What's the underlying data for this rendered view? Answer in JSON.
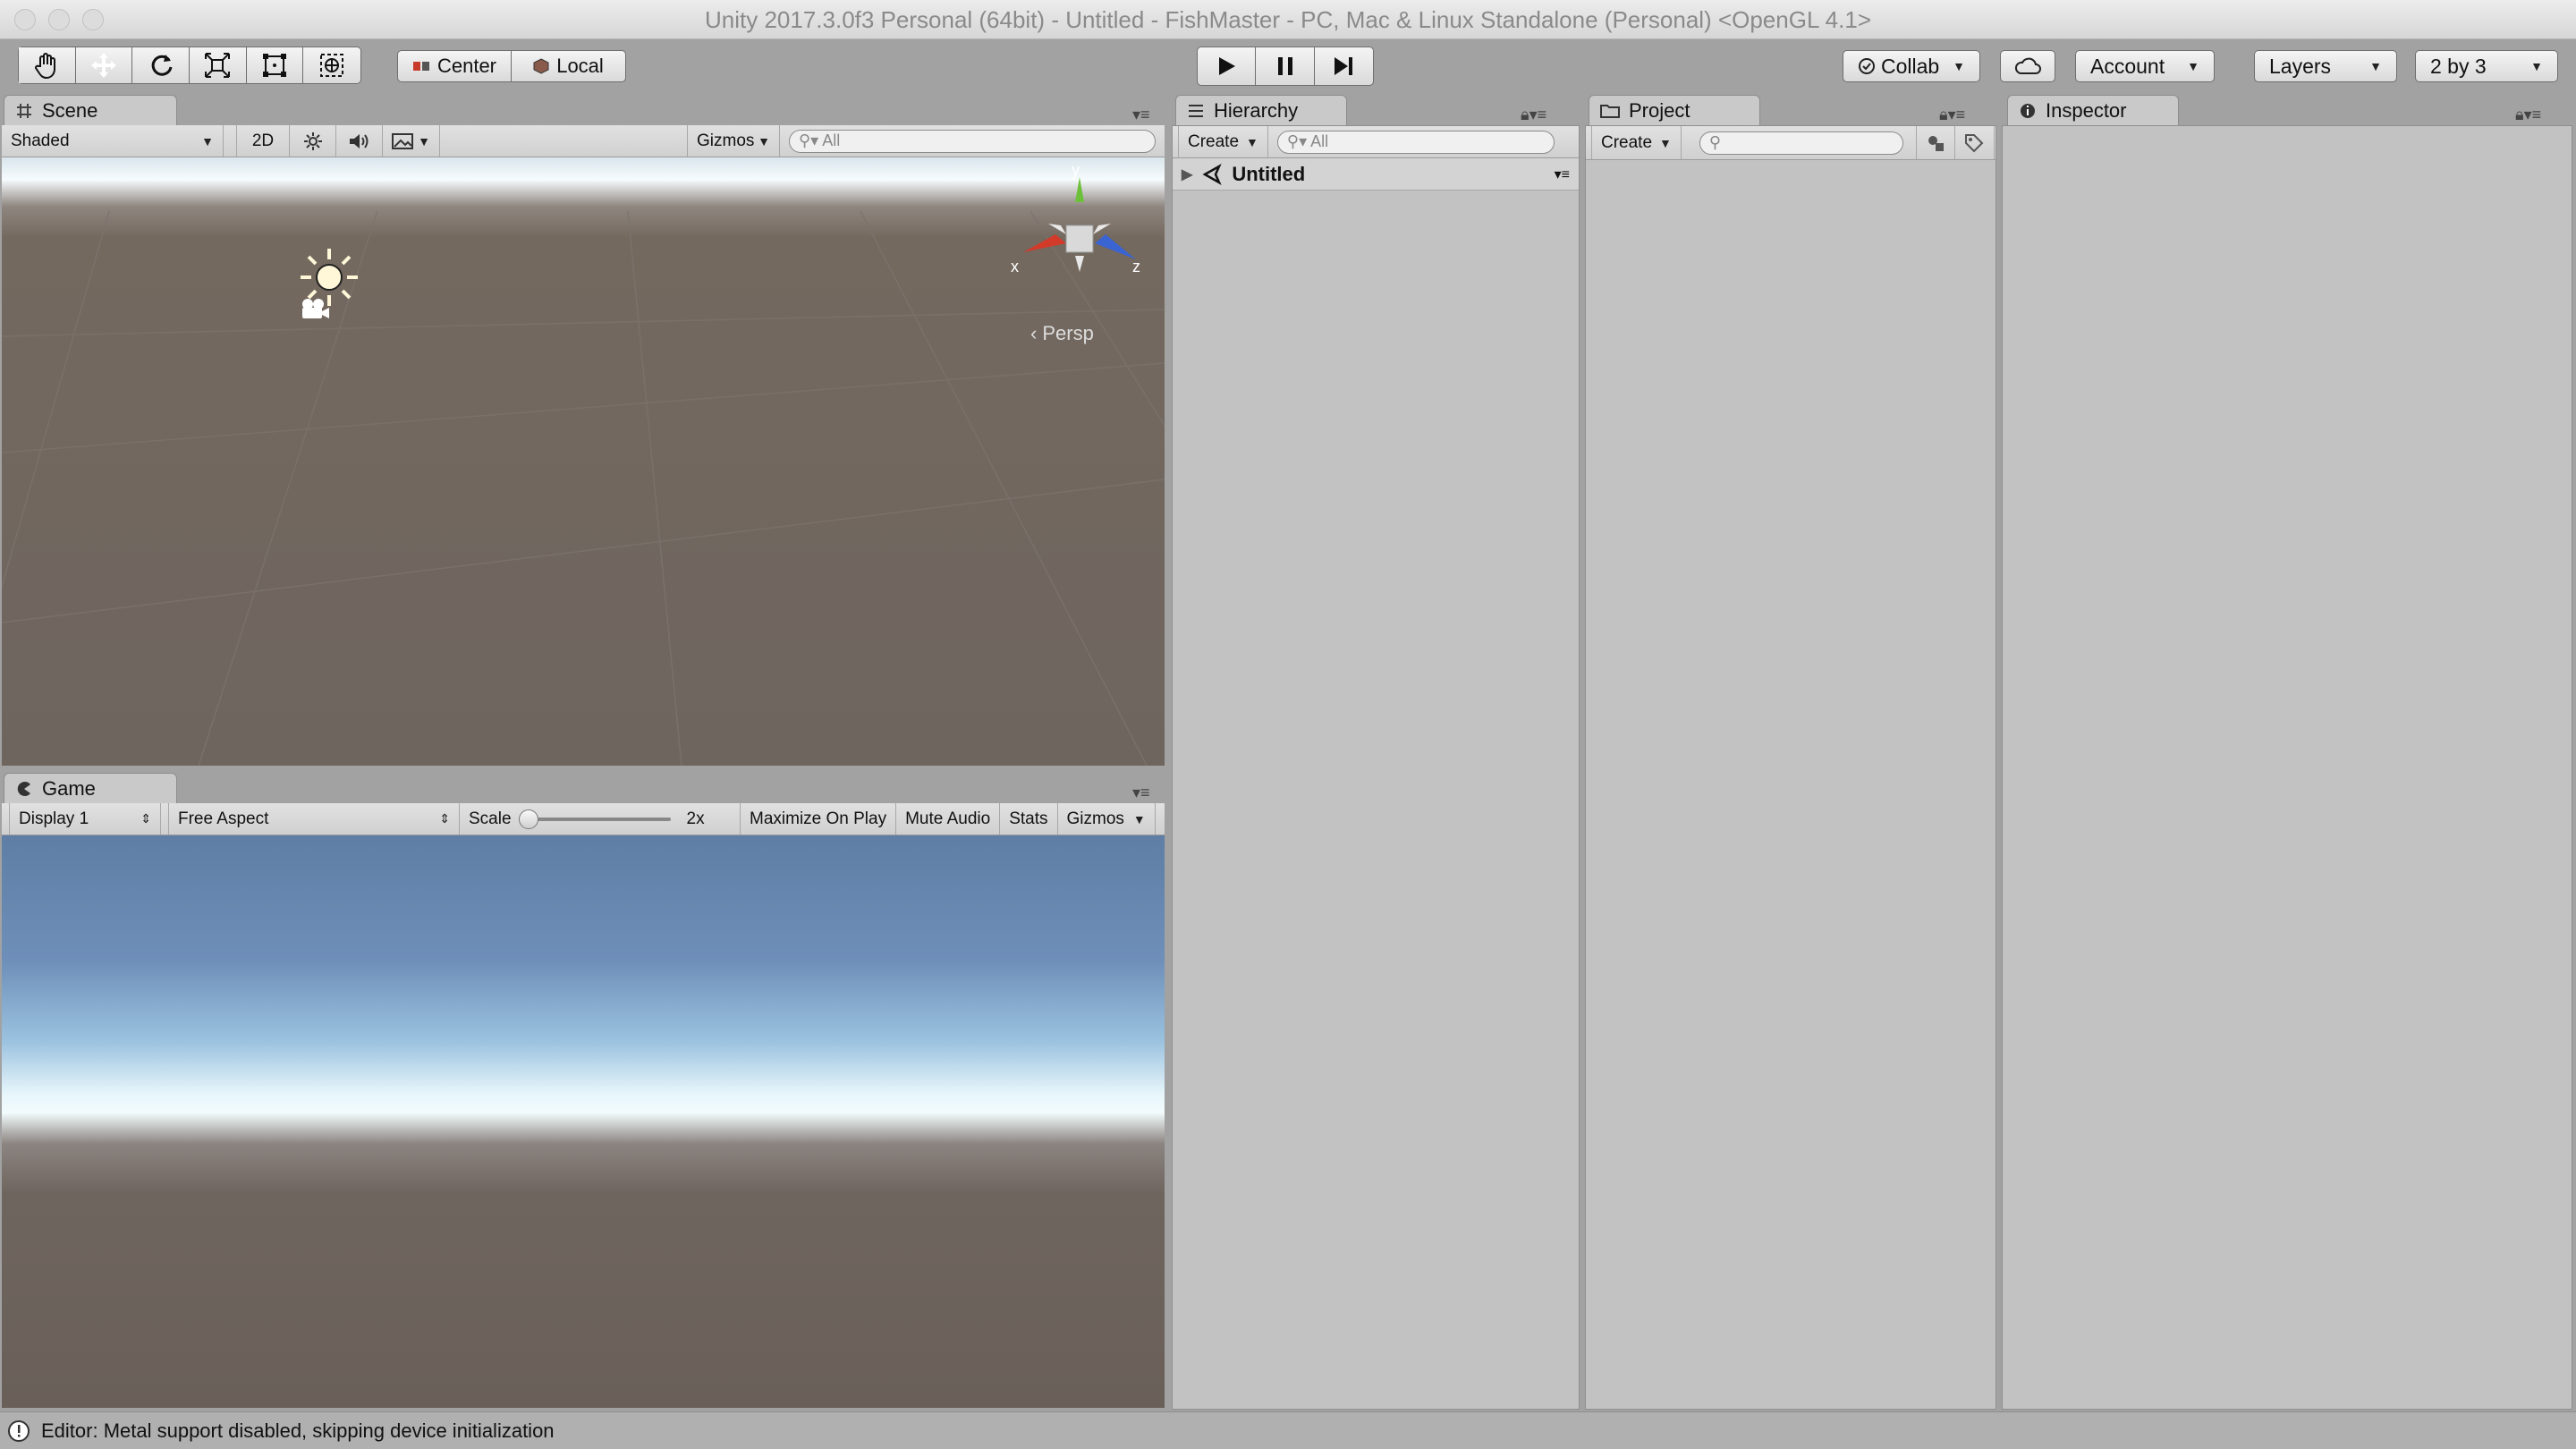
{
  "window": {
    "title": "Unity 2017.3.0f3 Personal (64bit) - Untitled - FishMaster - PC, Mac & Linux Standalone (Personal) <OpenGL 4.1>"
  },
  "toolbar": {
    "tools": [
      {
        "icon": "hand-icon"
      },
      {
        "icon": "move-icon"
      },
      {
        "icon": "rotate-icon"
      },
      {
        "icon": "scale-icon"
      },
      {
        "icon": "rect-icon"
      },
      {
        "icon": "transform-icon"
      }
    ],
    "pivot_label": "Center",
    "space_label": "Local",
    "collab_label": "Collab",
    "account_label": "Account",
    "layers_label": "Layers",
    "layout_label": "2 by 3",
    "colors": {
      "selected": "#666666",
      "accent_x": "#d23a2a",
      "accent_y": "#6dc13a",
      "accent_z": "#3a64d2"
    }
  },
  "scene": {
    "tab_label": "Scene",
    "shading_mode": "Shaded",
    "mode_2d": "2D",
    "gizmos_label": "Gizmos",
    "search_placeholder": "All",
    "axis_x": "x",
    "axis_y": "y",
    "axis_z": "z",
    "projection_label": "Persp"
  },
  "game": {
    "tab_label": "Game",
    "display": "Display 1",
    "aspect": "Free Aspect",
    "scale_label": "Scale",
    "scale_value": "2x",
    "maximize_label": "Maximize On Play",
    "mute_label": "Mute Audio",
    "stats_label": "Stats",
    "gizmos_label": "Gizmos"
  },
  "hierarchy": {
    "tab_label": "Hierarchy",
    "create_label": "Create",
    "search_placeholder": "All",
    "scene_name": "Untitled"
  },
  "project": {
    "tab_label": "Project",
    "create_label": "Create"
  },
  "inspector": {
    "tab_label": "Inspector"
  },
  "status": {
    "message": "Editor: Metal support disabled, skipping device initialization"
  }
}
